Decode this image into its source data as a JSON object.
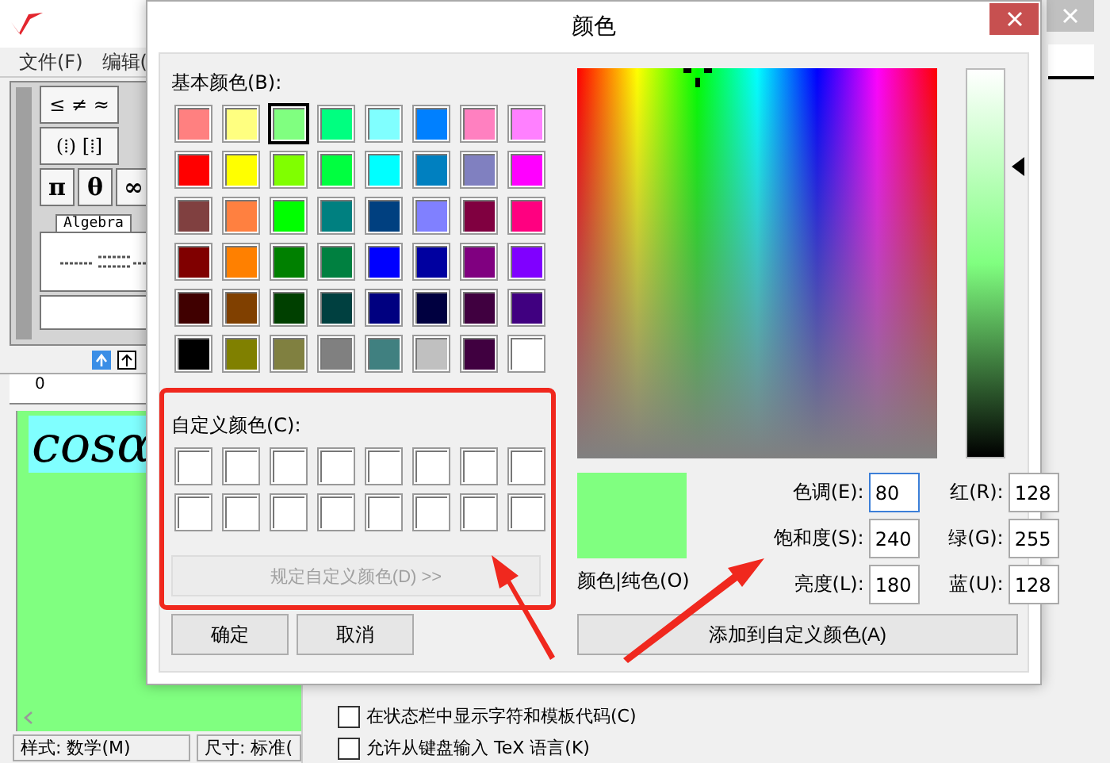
{
  "main_window": {
    "menu": [
      "文件(F)",
      "编辑("
    ],
    "palette_rows": [
      [
        "≤ ≠ ≈"
      ],
      [
        "(⁞) [⁞]"
      ],
      [
        "π",
        "θ",
        "∞"
      ]
    ],
    "palette_tab": "Algebra",
    "ruler_label": "0",
    "formula": "cosα",
    "status_bar": [
      "样式: 数学(M)",
      "尺寸: 标准("
    ]
  },
  "options_window": {
    "checkboxes": [
      {
        "label": "在状态栏中显示字符和模板代码(C)",
        "checked": false
      },
      {
        "label": "允许从键盘输入 TeX 语言(K)",
        "checked": false
      }
    ]
  },
  "dialog": {
    "title": "颜色",
    "basic_colors_label": "基本颜色(B):",
    "basic_colors": [
      {
        "color": "#ff8080",
        "selected": false
      },
      {
        "color": "#ffff80",
        "selected": false
      },
      {
        "color": "#80ff80",
        "selected": true
      },
      {
        "color": "#00ff80",
        "selected": false
      },
      {
        "color": "#80ffff",
        "selected": false
      },
      {
        "color": "#0080ff",
        "selected": false
      },
      {
        "color": "#ff80c0",
        "selected": false
      },
      {
        "color": "#ff80ff",
        "selected": false
      },
      {
        "color": "#ff0000",
        "selected": false
      },
      {
        "color": "#ffff00",
        "selected": false
      },
      {
        "color": "#80ff00",
        "selected": false
      },
      {
        "color": "#00ff40",
        "selected": false
      },
      {
        "color": "#00ffff",
        "selected": false
      },
      {
        "color": "#0080c0",
        "selected": false
      },
      {
        "color": "#8080c0",
        "selected": false
      },
      {
        "color": "#ff00ff",
        "selected": false
      },
      {
        "color": "#804040",
        "selected": false
      },
      {
        "color": "#ff8040",
        "selected": false
      },
      {
        "color": "#00ff00",
        "selected": false
      },
      {
        "color": "#008080",
        "selected": false
      },
      {
        "color": "#004080",
        "selected": false
      },
      {
        "color": "#8080ff",
        "selected": false
      },
      {
        "color": "#800040",
        "selected": false
      },
      {
        "color": "#ff0080",
        "selected": false
      },
      {
        "color": "#800000",
        "selected": false
      },
      {
        "color": "#ff8000",
        "selected": false
      },
      {
        "color": "#008000",
        "selected": false
      },
      {
        "color": "#008040",
        "selected": false
      },
      {
        "color": "#0000ff",
        "selected": false
      },
      {
        "color": "#0000a0",
        "selected": false
      },
      {
        "color": "#800080",
        "selected": false
      },
      {
        "color": "#8000ff",
        "selected": false
      },
      {
        "color": "#400000",
        "selected": false
      },
      {
        "color": "#804000",
        "selected": false
      },
      {
        "color": "#004000",
        "selected": false
      },
      {
        "color": "#004040",
        "selected": false
      },
      {
        "color": "#000080",
        "selected": false
      },
      {
        "color": "#000040",
        "selected": false
      },
      {
        "color": "#400040",
        "selected": false
      },
      {
        "color": "#400080",
        "selected": false
      },
      {
        "color": "#000000",
        "selected": false
      },
      {
        "color": "#808000",
        "selected": false
      },
      {
        "color": "#808040",
        "selected": false
      },
      {
        "color": "#808080",
        "selected": false
      },
      {
        "color": "#408080",
        "selected": false
      },
      {
        "color": "#c0c0c0",
        "selected": false
      },
      {
        "color": "#400040",
        "selected": false
      },
      {
        "color": "#ffffff",
        "selected": false
      }
    ],
    "custom_colors_label": "自定义颜色(C):",
    "custom_colors": [
      {
        "color": "#ffffff"
      },
      {
        "color": "#ffffff"
      },
      {
        "color": "#ffffff"
      },
      {
        "color": "#ffffff"
      },
      {
        "color": "#ffffff"
      },
      {
        "color": "#ffffff"
      },
      {
        "color": "#ffffff"
      },
      {
        "color": "#ffffff"
      },
      {
        "color": "#ffffff"
      },
      {
        "color": "#ffffff"
      },
      {
        "color": "#ffffff"
      },
      {
        "color": "#ffffff"
      },
      {
        "color": "#ffffff"
      },
      {
        "color": "#ffffff"
      },
      {
        "color": "#ffffff"
      },
      {
        "color": "#ffffff"
      }
    ],
    "define_button": {
      "label": "规定自定义颜色(D) >>",
      "disabled": true
    },
    "ok_button": "确定",
    "cancel_button": "取消",
    "preview_label": "颜色|纯色(O)",
    "hsl_fields": [
      {
        "label": "色调(E):",
        "value": "80"
      },
      {
        "label": "饱和度(S):",
        "value": "240"
      },
      {
        "label": "亮度(L):",
        "value": "180"
      }
    ],
    "rgb_fields": [
      {
        "label": "红(R):",
        "value": "128"
      },
      {
        "label": "绿(G):",
        "value": "255"
      },
      {
        "label": "蓝(U):",
        "value": "128"
      }
    ],
    "add_button": "添加到自定义颜色(A)"
  }
}
